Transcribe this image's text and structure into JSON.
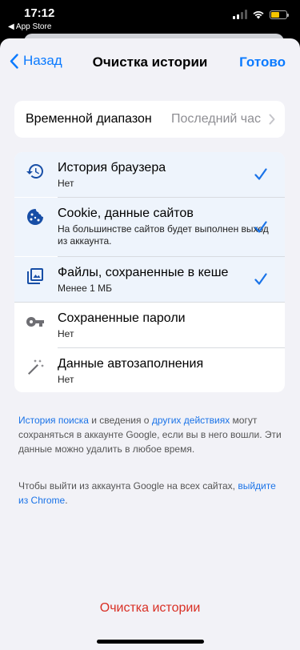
{
  "status_bar": {
    "time": "17:12",
    "back_app": "◀ App Store",
    "battery_color": "#f5c400"
  },
  "nav": {
    "back_label": "Назад",
    "title": "Очистка истории",
    "done_label": "Готово",
    "accent": "#0a7aff"
  },
  "time_range": {
    "label": "Временной диапазон",
    "value": "Последний час"
  },
  "items": [
    {
      "title": "История браузера",
      "subtitle": "Нет",
      "icon": "history-icon",
      "checked": true
    },
    {
      "title": "Cookie, данные сайтов",
      "subtitle": "На большинстве сайтов будет выполнен выход из аккаунта.",
      "icon": "cookie-icon",
      "checked": true
    },
    {
      "title": "Файлы, сохраненные в кеше",
      "subtitle": "Менее 1 МБ",
      "icon": "image-icon",
      "checked": true
    },
    {
      "title": "Сохраненные пароли",
      "subtitle": "Нет",
      "icon": "key-icon",
      "checked": false
    },
    {
      "title": "Данные автозаполнения",
      "subtitle": "Нет",
      "icon": "magic-wand-icon",
      "checked": false
    }
  ],
  "info1": {
    "link1": "История поиска",
    "text1": " и сведения о ",
    "link2": "других действиях",
    "text2": " могут сохраняться в аккаунте Google, если вы в него вошли. Эти данные можно удалить в любое время."
  },
  "info2": {
    "text1": "Чтобы выйти из аккаунта Google на всех сайтах, ",
    "link": "выйдите из Chrome",
    "text2": "."
  },
  "clear_button": {
    "label": "Очистка истории",
    "color": "#d93025"
  }
}
